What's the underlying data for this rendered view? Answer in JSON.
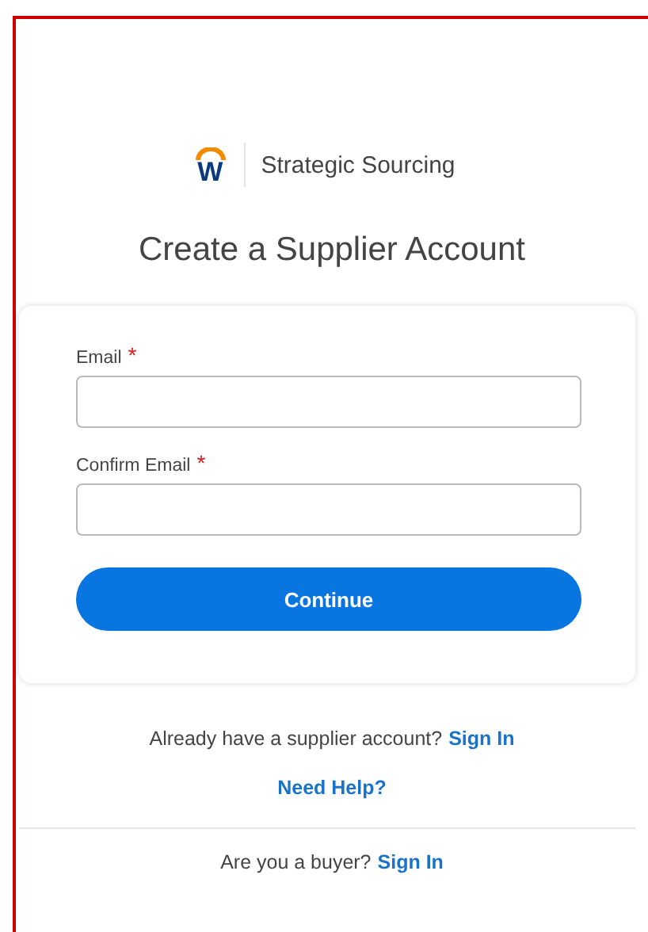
{
  "brand": {
    "logo_letter": "W",
    "product": "Strategic Sourcing"
  },
  "title": "Create a Supplier Account",
  "form": {
    "fields": [
      {
        "label": "Email",
        "required_mark": "*"
      },
      {
        "label": "Confirm Email",
        "required_mark": "*"
      }
    ],
    "submit": "Continue"
  },
  "signin_prompt": {
    "text": "Already have a supplier account?",
    "link": "Sign In"
  },
  "help_link": "Need Help?",
  "buyer_prompt": {
    "text": "Are you a buyer?",
    "link": "Sign In"
  }
}
